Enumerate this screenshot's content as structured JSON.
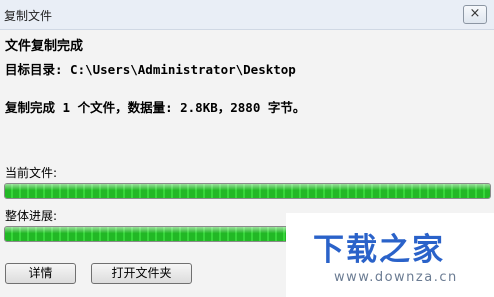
{
  "window": {
    "title": "复制文件",
    "close_label": "×"
  },
  "content": {
    "heading": "文件复制完成",
    "target_dir": "目标目录: C:\\Users\\Administrator\\Desktop",
    "summary": "复制完成 1 个文件，数据量: 2.8KB，2880 字节。",
    "current_file_label": "当前文件:",
    "current_file_progress": 1.0,
    "overall_progress_label": "整体进展:",
    "overall_progress": 1.0
  },
  "buttons": {
    "details": "详情",
    "open_folder": "打开文件夹"
  },
  "watermark": {
    "logo": "下载之家",
    "url": "www.downza.cn"
  },
  "colors": {
    "progress_fill": "#22b825",
    "watermark_blue": "#2a62c9"
  }
}
